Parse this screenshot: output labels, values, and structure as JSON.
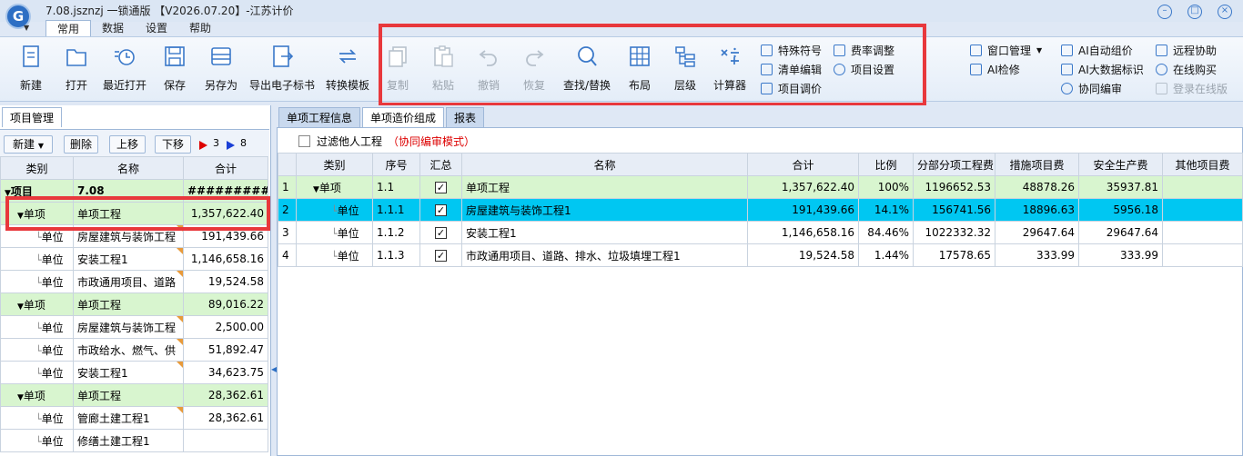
{
  "window": {
    "title": "7.08.jsznzj 一锁通版 【V2026.07.20】-江苏计价",
    "logo_text": "G"
  },
  "menu_tabs": [
    "常用",
    "数据",
    "设置",
    "帮助"
  ],
  "ribbon": {
    "big_buttons": [
      {
        "label": "新建",
        "icon": "new-file-icon"
      },
      {
        "label": "打开",
        "icon": "open-folder-icon"
      },
      {
        "label": "最近打开",
        "icon": "recent-icon"
      },
      {
        "label": "保存",
        "icon": "save-icon"
      },
      {
        "label": "另存为",
        "icon": "save-as-icon"
      },
      {
        "label": "导出电子标书",
        "icon": "export-icon"
      },
      {
        "label": "转换模板",
        "icon": "convert-icon"
      },
      {
        "label": "复制",
        "icon": "copy-icon",
        "disabled": true
      },
      {
        "label": "粘贴",
        "icon": "paste-icon",
        "disabled": true
      },
      {
        "label": "撤销",
        "icon": "undo-icon",
        "disabled": true
      },
      {
        "label": "恢复",
        "icon": "redo-icon",
        "disabled": true
      },
      {
        "label": "查找/替换",
        "icon": "search-icon"
      },
      {
        "label": "布局",
        "icon": "layout-grid-icon"
      },
      {
        "label": "层级",
        "icon": "hierarchy-icon"
      },
      {
        "label": "计算器",
        "icon": "calculator-icon"
      }
    ],
    "small_group1": [
      "特殊符号",
      "清单编辑",
      "项目调价"
    ],
    "small_group2": [
      "费率调整",
      "项目设置"
    ],
    "small_group3": [
      "窗口管理",
      "AI检修"
    ],
    "small_group4": [
      "AI自动组价",
      "AI大数据标识",
      "协同编审"
    ],
    "small_group5": [
      "远程协助",
      "在线购买",
      "登录在线版"
    ]
  },
  "left_panel": {
    "tab": "项目管理",
    "toolbar": {
      "new": "新建",
      "delete": "删除",
      "up": "上移",
      "down": "下移",
      "red_flag_count": "3",
      "blue_flag_count": "8"
    },
    "columns": [
      "类别",
      "名称",
      "合计"
    ],
    "rows": [
      {
        "type": "项目",
        "name": "7.08",
        "total": "###########",
        "level": 0
      },
      {
        "type": "单项",
        "name": "单项工程",
        "total": "1,357,622.40",
        "level": 1
      },
      {
        "type": "单位",
        "name": "房屋建筑与装饰工程",
        "total": "191,439.66",
        "level": 2
      },
      {
        "type": "单位",
        "name": "安装工程1",
        "total": "1,146,658.16",
        "level": 2
      },
      {
        "type": "单位",
        "name": "市政通用项目、道路",
        "total": "19,524.58",
        "level": 2
      },
      {
        "type": "单项",
        "name": "单项工程",
        "total": "89,016.22",
        "level": 1
      },
      {
        "type": "单位",
        "name": "房屋建筑与装饰工程",
        "total": "2,500.00",
        "level": 2
      },
      {
        "type": "单位",
        "name": "市政给水、燃气、供",
        "total": "51,892.47",
        "level": 2
      },
      {
        "type": "单位",
        "name": "安装工程1",
        "total": "34,623.75",
        "level": 2
      },
      {
        "type": "单项",
        "name": "单项工程",
        "total": "28,362.61",
        "level": 1
      },
      {
        "type": "单位",
        "name": "管廊土建工程1",
        "total": "28,362.61",
        "level": 2
      },
      {
        "type": "单位",
        "name": "修缮土建工程1",
        "total": "",
        "level": 2
      }
    ]
  },
  "right_panel": {
    "tabs": [
      "单项工程信息",
      "单项造价组成",
      "报表"
    ],
    "filter_label": "过滤他人工程",
    "mode_label": "（协同编审模式）",
    "columns": [
      "类别",
      "序号",
      "汇总",
      "名称",
      "合计",
      "比例",
      "分部分项工程费",
      "措施项目费",
      "安全生产费",
      "其他项目费"
    ],
    "rows": [
      {
        "no": "1",
        "type": "单项",
        "seq": "1.1",
        "checked": true,
        "name": "单项工程",
        "total": "1,357,622.40",
        "ratio": "100%",
        "fbfx": "1196652.53",
        "csxm": "48878.26",
        "aqsc": "35937.81",
        "qtxm": ""
      },
      {
        "no": "2",
        "type": "单位",
        "seq": "1.1.1",
        "checked": true,
        "name": "房屋建筑与装饰工程1",
        "total": "191,439.66",
        "ratio": "14.1%",
        "fbfx": "156741.56",
        "csxm": "18896.63",
        "aqsc": "5956.18",
        "qtxm": ""
      },
      {
        "no": "3",
        "type": "单位",
        "seq": "1.1.2",
        "checked": true,
        "name": "安装工程1",
        "total": "1,146,658.16",
        "ratio": "84.46%",
        "fbfx": "1022332.32",
        "csxm": "29647.64",
        "aqsc": "29647.64",
        "qtxm": ""
      },
      {
        "no": "4",
        "type": "单位",
        "seq": "1.1.3",
        "checked": true,
        "name": "市政通用项目、道路、排水、垃圾填埋工程1",
        "total": "19,524.58",
        "ratio": "1.44%",
        "fbfx": "17578.65",
        "csxm": "333.99",
        "aqsc": "333.99",
        "qtxm": ""
      }
    ]
  },
  "colors": {
    "highlight_red": "#e8383c",
    "selected_row": "#00c7f2",
    "group_row": "#d8f5cf"
  }
}
